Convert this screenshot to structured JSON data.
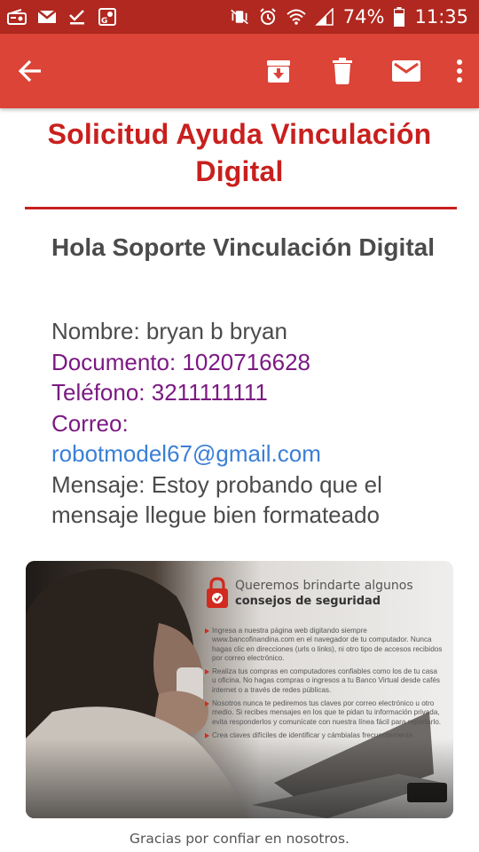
{
  "status_bar": {
    "battery": "74%",
    "time": "11:35",
    "left_icons": [
      "radio-icon",
      "gmail-icon",
      "download-done-icon",
      "maps-icon"
    ],
    "right_icons": [
      "vibrate-mute-icon",
      "alarm-icon",
      "wifi-icon",
      "signal-icon",
      "battery-icon"
    ]
  },
  "app_bar": {
    "background": "#db4437",
    "actions": [
      "archive-icon",
      "delete-icon",
      "mark-unread-icon",
      "more-vert-icon"
    ]
  },
  "email": {
    "title": "Solicitud Ayuda Vinculación Digital",
    "greeting": "Hola Soporte Vinculación Digital",
    "fields": {
      "nombre": "Nombre: bryan b bryan",
      "documento": "Documento: 1020716628",
      "telefono": "Teléfono: 3211111111",
      "correo_label": "Correo:",
      "correo_value": "robotmodel67@gmail.com",
      "mensaje": "Mensaje: Estoy probando que el mensaje llegue bien formateado"
    },
    "accent_color": "#c8201e",
    "field_color": "#7b1a82",
    "link_color": "#3b7fd6"
  },
  "banner": {
    "heading_1": "Queremos brindarte algunos",
    "heading_2": "consejos de seguridad",
    "tips": [
      "Ingresa a nuestra página web digitando siempre www.bancofinandina.com en el navegador de tu computador. Nunca hagas clic en direcciones (urls o links), ni otro tipo de accesos recibidos por correo electrónico.",
      "Realiza tus compras en computadores confiables como los de tu casa u oficina. No hagas compras o ingresos a tu Banco Virtual desde cafés internet o a través de redes públicas.",
      "Nosotros nunca te pediremos tus claves por correo electrónico u otro medio. Si recibes mensajes en los que te pidan tu información privada, evita responderlos y comunícate con nuestra línea fácil para reportarlo.",
      "Crea claves difíciles de identificar y cámbialas frecuentemente."
    ]
  },
  "footer": {
    "text": "Gracias por confiar en nosotros."
  }
}
